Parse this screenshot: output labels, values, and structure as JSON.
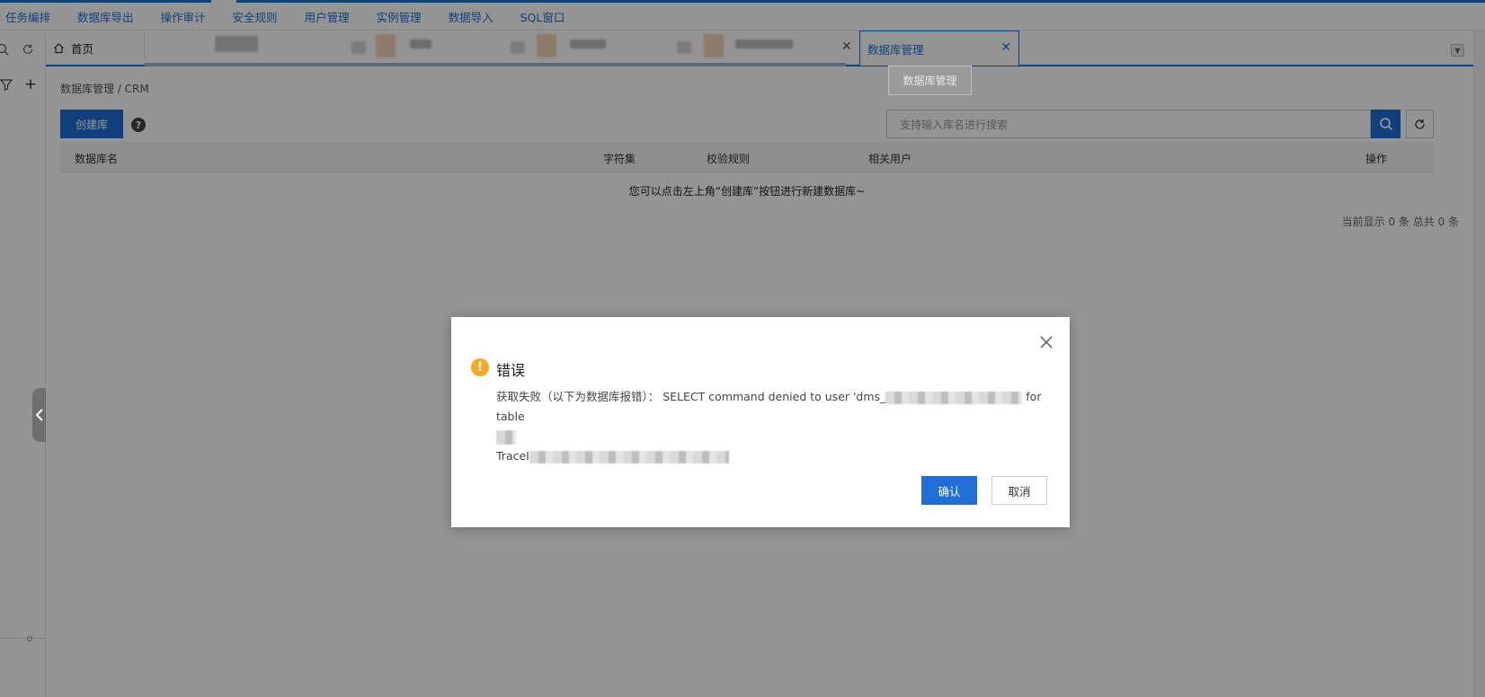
{
  "topnav": {
    "items": [
      "任务编排",
      "数据库导出",
      "操作审计",
      "安全规则",
      "用户管理",
      "实例管理",
      "数据导入",
      "SQL窗口"
    ]
  },
  "tabs": {
    "home_label": "首页",
    "active_label": "数据库管理",
    "tooltip": "数据库管理"
  },
  "breadcrumb": "数据库管理 / CRM",
  "toolbar": {
    "create_label": "创建库",
    "help_glyph": "?",
    "search_placeholder": "支持输入库名进行搜索"
  },
  "table": {
    "headers": [
      "数据库名",
      "字符集",
      "校验规则",
      "相关用户",
      "操作"
    ],
    "empty_text": "您可以点击左上角“创建库”按钮进行新建数据库~",
    "page_info": "当前显示 0 条 总共 0 条"
  },
  "dialog": {
    "title": "错误",
    "msg_prefix": "获取失败（以下为数据库报错）：  SELECT command denied to user 'dms_",
    "msg_suffix": " for table",
    "trace_label": "TraceI",
    "ok_label": "确认",
    "cancel_label": "取消"
  },
  "colors": {
    "accent": "#1f6fd6",
    "warning": "#f5a623"
  }
}
